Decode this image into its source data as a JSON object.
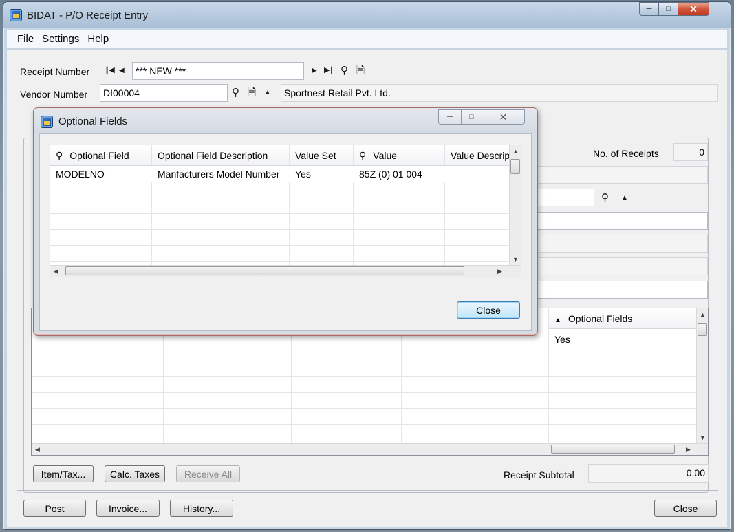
{
  "window": {
    "title": "BIDAT - P/O Receipt Entry"
  },
  "menu": {
    "items": [
      {
        "label": "File"
      },
      {
        "label": "Settings"
      },
      {
        "label": "Help"
      }
    ]
  },
  "receipt": {
    "label": "Receipt Number",
    "value": "*** NEW ***"
  },
  "vendor": {
    "label": "Vendor Number",
    "value": "DI00004",
    "name": "Sportnest Retail Pvt. Ltd."
  },
  "receipts_count": {
    "label": "No. of Receipts",
    "value": "0"
  },
  "main_grid": {
    "optional_fields_header": "Optional Fields",
    "first_row_value": "Yes"
  },
  "buttons": {
    "item_tax": "Item/Tax...",
    "calc_taxes": "Calc. Taxes",
    "receive_all": "Receive All",
    "post": "Post",
    "invoice": "Invoice...",
    "history": "History...",
    "close": "Close"
  },
  "subtotal": {
    "label": "Receipt Subtotal",
    "value": "0.00"
  },
  "dialog": {
    "title": "Optional Fields",
    "columns": [
      "Optional Field",
      "Optional Field Description",
      "Value Set",
      "Value",
      "Value Descrip"
    ],
    "rows": [
      {
        "field": "MODELNO",
        "description": "Manfacturers Model Number",
        "value_set": "Yes",
        "value": "85Z (0) 01 004",
        "value_desc": ""
      }
    ],
    "close_label": "Close"
  },
  "icons": {
    "first": "first-record-icon",
    "prev": "previous-record-icon",
    "next": "next-record-icon",
    "last": "last-record-icon",
    "finder": "search-icon",
    "new": "new-document-icon",
    "zoom": "zoom-up-icon"
  }
}
